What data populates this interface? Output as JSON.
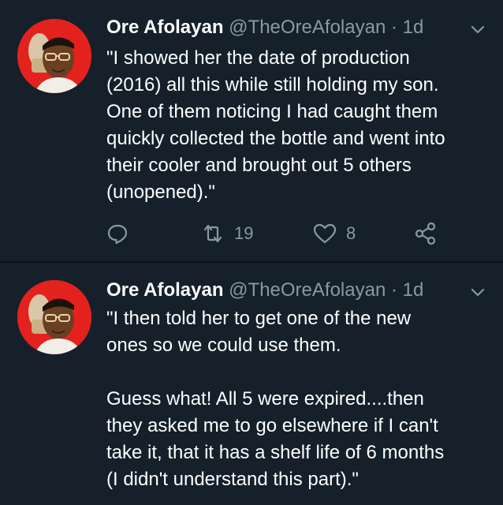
{
  "colors": {
    "background": "#15202b",
    "text": "#ffffff",
    "muted": "#8899a6"
  },
  "tweets": [
    {
      "author_name": "Ore Afolayan",
      "handle": "@TheOreAfolayan",
      "separator": "·",
      "time": "1d",
      "lines": [
        "\"I showed her the date of production",
        "(2016) all this while still holding my son.",
        "One of them noticing I had caught them",
        "quickly collected the bottle and went into",
        "their cooler and brought out 5 others",
        "(unopened).\""
      ],
      "retweets": "19",
      "likes": "8",
      "icons": [
        "reply-icon",
        "retweet-icon",
        "heart-icon",
        "share-icon",
        "chevron-down-icon"
      ]
    },
    {
      "author_name": "Ore Afolayan",
      "handle": "@TheOreAfolayan",
      "separator": "·",
      "time": "1d",
      "lines": [
        "\"I then told her to get one of the new",
        "ones so we could use them.",
        "",
        "Guess what! All 5 were expired....then",
        "they asked me to go elsewhere if I can't",
        "take it, that it has a shelf life of 6 months",
        "(I didn't understand this part).\""
      ],
      "icons": [
        "chevron-down-icon"
      ]
    }
  ]
}
